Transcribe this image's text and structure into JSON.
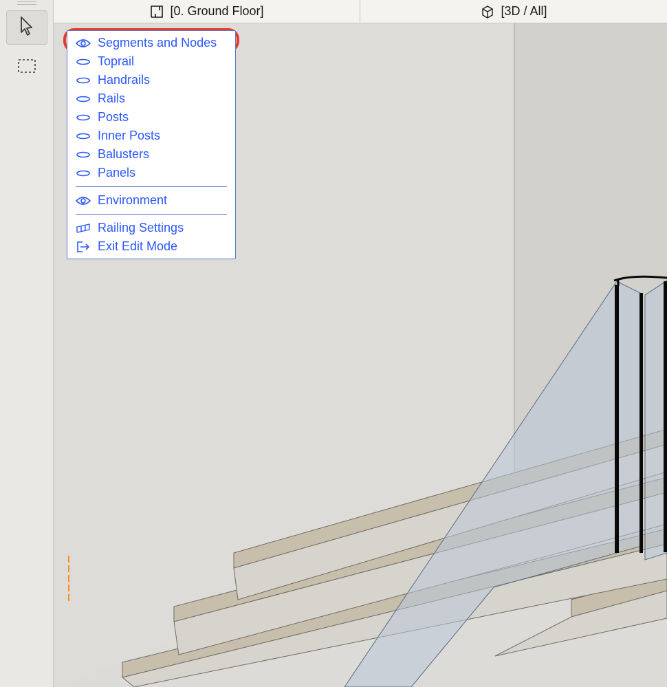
{
  "tabs": {
    "floor": "[0. Ground Floor]",
    "view3d": "[3D / All]"
  },
  "menu": {
    "segments": "Segments and Nodes",
    "toprail": "Toprail",
    "handrails": "Handrails",
    "rails": "Rails",
    "posts": "Posts",
    "inner_posts": "Inner Posts",
    "balusters": "Balusters",
    "panels": "Panels",
    "environment": "Environment",
    "railing_settings": "Railing Settings",
    "exit": "Exit Edit Mode"
  }
}
